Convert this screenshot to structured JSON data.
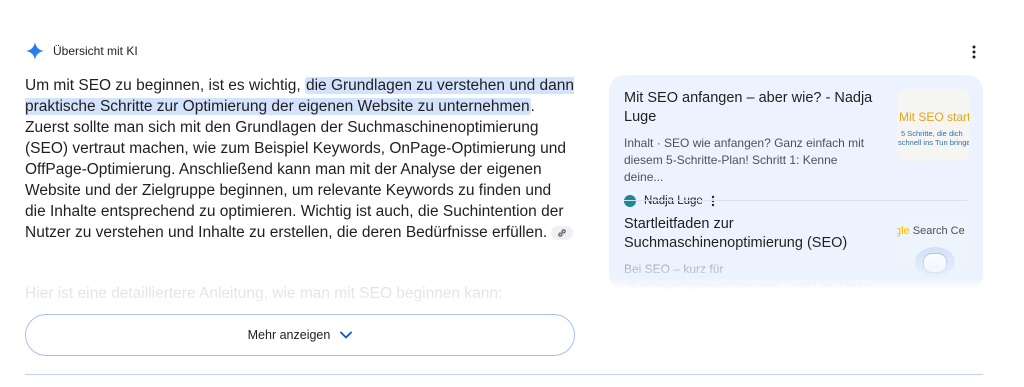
{
  "header": {
    "title": "Übersicht mit KI"
  },
  "answer": {
    "intro": "Um mit SEO zu beginnen, ist es wichtig, ",
    "highlight": "die Grundlagen zu verstehen und dann praktische Schritte zur Optimierung der eigenen Website zu unternehmen",
    "body": ". Zuerst sollte man sich mit den Grundlagen der Suchmaschinenoptimierung (SEO) vertraut machen, wie zum Beispiel Keywords, OnPage-Optimierung und OffPage-Optimierung. Anschließend kann man mit der Analyse der eigenen Website und der Zielgruppe beginnen, um relevante Keywords zu finden und die Inhalte entsprechend zu optimieren. Wichtig ist auch, die Suchintention der Nutzer zu verstehen und Inhalte zu erstellen, die deren Bedürfnisse erfüllen.",
    "faded_line": "Hier ist eine detailliertere Anleitung, wie man mit SEO beginnen kann:"
  },
  "show_more": {
    "label": "Mehr anzeigen"
  },
  "sources": [
    {
      "title": "Mit SEO anfangen – aber wie? - Nadja Luge",
      "snippet": "Inhalt · SEO wie anfangen? Ganz einfach mit diesem 5-Schritte-Plan! Schritt 1: Kenne deine...",
      "site_name": "Nadja Luge",
      "thumb_title": "Mit SEO starten",
      "thumb_caption_1": "5 Schritte, die dich",
      "thumb_caption_2": "schnell ins Tun bringen"
    },
    {
      "title": "Startleitfaden zur Suchmaschinenoptimierung (SEO)",
      "snippet": "Bei SEO – kurz für „Suchmaschinenoptimierung“ – geht es darum, Suchmaschinen dabei zu...",
      "site_name": "",
      "thumb_title_prefix": "gle",
      "thumb_title_rest": " Search Ce"
    }
  ],
  "colors": {
    "accent_blue": "#0b57d0",
    "highlight": "#d3e3fd",
    "panel_bg": "#edf3fe",
    "button_border": "#a8c0f0"
  }
}
